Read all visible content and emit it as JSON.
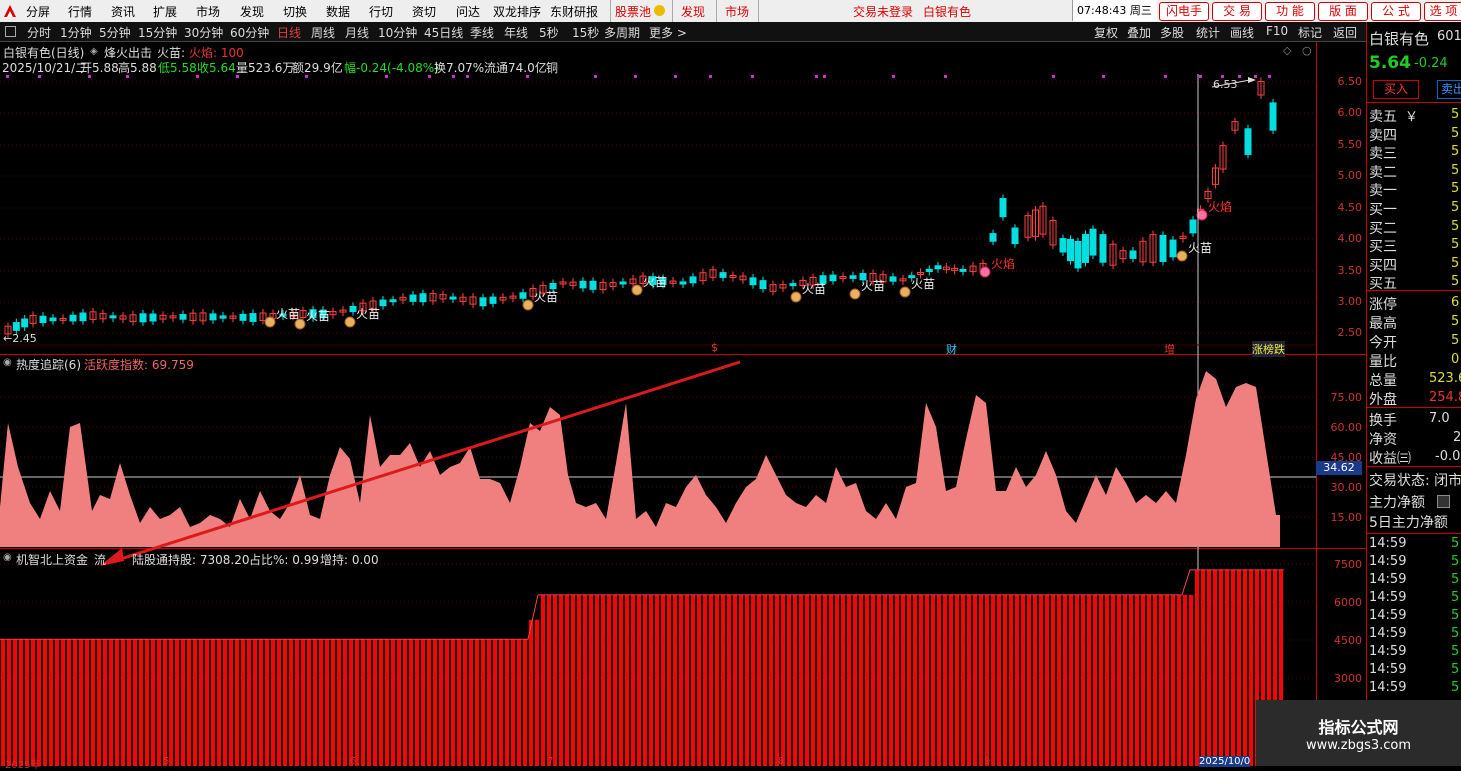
{
  "menu": {
    "items": [
      "分屏",
      "行情",
      "资讯",
      "扩展",
      "市场",
      "发现",
      "切换",
      "数据",
      "行切",
      "资切",
      "问达",
      "双龙排序",
      "东财研报"
    ],
    "pool": "股票池",
    "discover": "发现",
    "market": "市场",
    "trade_status": "交易未登录",
    "stock": "白银有色",
    "time": "07:48:43 周三",
    "buttons": [
      "闪电手",
      "交 易",
      "功 能",
      "版 面",
      "公 式",
      "选 项"
    ]
  },
  "periods": [
    "分时",
    "1分钟",
    "5分钟",
    "15分钟",
    "30分钟",
    "60分钟",
    "日线",
    "周线",
    "月线",
    "10分钟",
    "45日线",
    "季线",
    "年线",
    "5秒",
    "15秒",
    "多周期",
    "更多 >"
  ],
  "active_period": "日线",
  "right_tools": [
    "复权",
    "叠加",
    "多股",
    "统计",
    "画线",
    "F10",
    "标记",
    "返回"
  ],
  "main": {
    "title": "白银有色(日线)",
    "indicator": "烽火出击",
    "miao": "火苗:",
    "flame": "火焰: 100",
    "date": "2025/10/21/二",
    "open": "开5.88",
    "high": "高5.88",
    "low": "低5.58",
    "close": "收5.64",
    "vol": "量523.6万",
    "amount": "额29.9亿",
    "change": "幅-0.24(-4.08%)",
    "turnover": "换7.07%",
    "float": "流通74.0亿",
    "tag": "铜",
    "y_labels": [
      "6.50",
      "6.00",
      "5.50",
      "5.00",
      "4.50",
      "4.00",
      "3.50",
      "3.00",
      "2.50"
    ],
    "low_mark": "←2.45",
    "high_mark": "6.53",
    "event_dollar": "$",
    "event_cai": "财",
    "event_zeng": "增",
    "event_zdt": "涨榜跌"
  },
  "heat": {
    "title": "热度追踪(6)",
    "label": "活跃度指数: 69.759",
    "y_labels": [
      "75.00",
      "60.00",
      "45.00",
      "30.00",
      "15.00"
    ],
    "cursor_value": "34.62"
  },
  "north": {
    "title": "机智北上资金",
    "flow": "流",
    "holding": "陆股通持股: 7308.20",
    "ratio": "占比%: 0.99",
    "add": "增持: 0.00",
    "y_labels": [
      "7500",
      "6000",
      "4500",
      "3000"
    ],
    "x_labels": [
      "2025年",
      "5",
      "6",
      "7",
      "8",
      "9",
      "2025/10/0"
    ]
  },
  "quote": {
    "name": "白银有色",
    "code": "601",
    "price": "5.64",
    "change": "-0.24",
    "buy_btn": "买入",
    "sell_btn": "卖出",
    "book": [
      "卖五",
      "卖四",
      "卖三",
      "卖二",
      "卖一",
      "买一",
      "买二",
      "买三",
      "买四",
      "买五"
    ],
    "book_vals": [
      "5",
      "5",
      "5",
      "5",
      "5",
      "5",
      "5",
      "5",
      "5",
      "5"
    ],
    "yen": "￥",
    "stats_labels": [
      "涨停",
      "最高",
      "今开",
      "量比",
      "总量",
      "外盘"
    ],
    "stats_vals": [
      "6",
      "5",
      "5",
      "0",
      "523.6",
      "254.8"
    ],
    "stats2_labels": [
      "换手",
      "净资",
      "收益㈢"
    ],
    "stats2_vals": [
      "7.0",
      "2",
      "-0.0"
    ],
    "trade_state": "交易状态: 闭市",
    "main_flow": "主力净额",
    "main_flow5": "5日主力净额",
    "ticks": [
      "14:59",
      "14:59",
      "14:59",
      "14:59",
      "14:59",
      "14:59",
      "14:59",
      "14:59",
      "14:59"
    ],
    "tick_vals": [
      "5",
      "5",
      "5",
      "5",
      "5",
      "5",
      "5",
      "5",
      "5"
    ]
  },
  "watermark": {
    "line1": "指标公式网",
    "line2": "www.zbgs3.com"
  },
  "colors": {
    "up": "#ff3333",
    "down": "#00e0e0",
    "panel_red": "#cc0000",
    "heat_fill": "#f08080",
    "bar_red": "#ff0000"
  }
}
